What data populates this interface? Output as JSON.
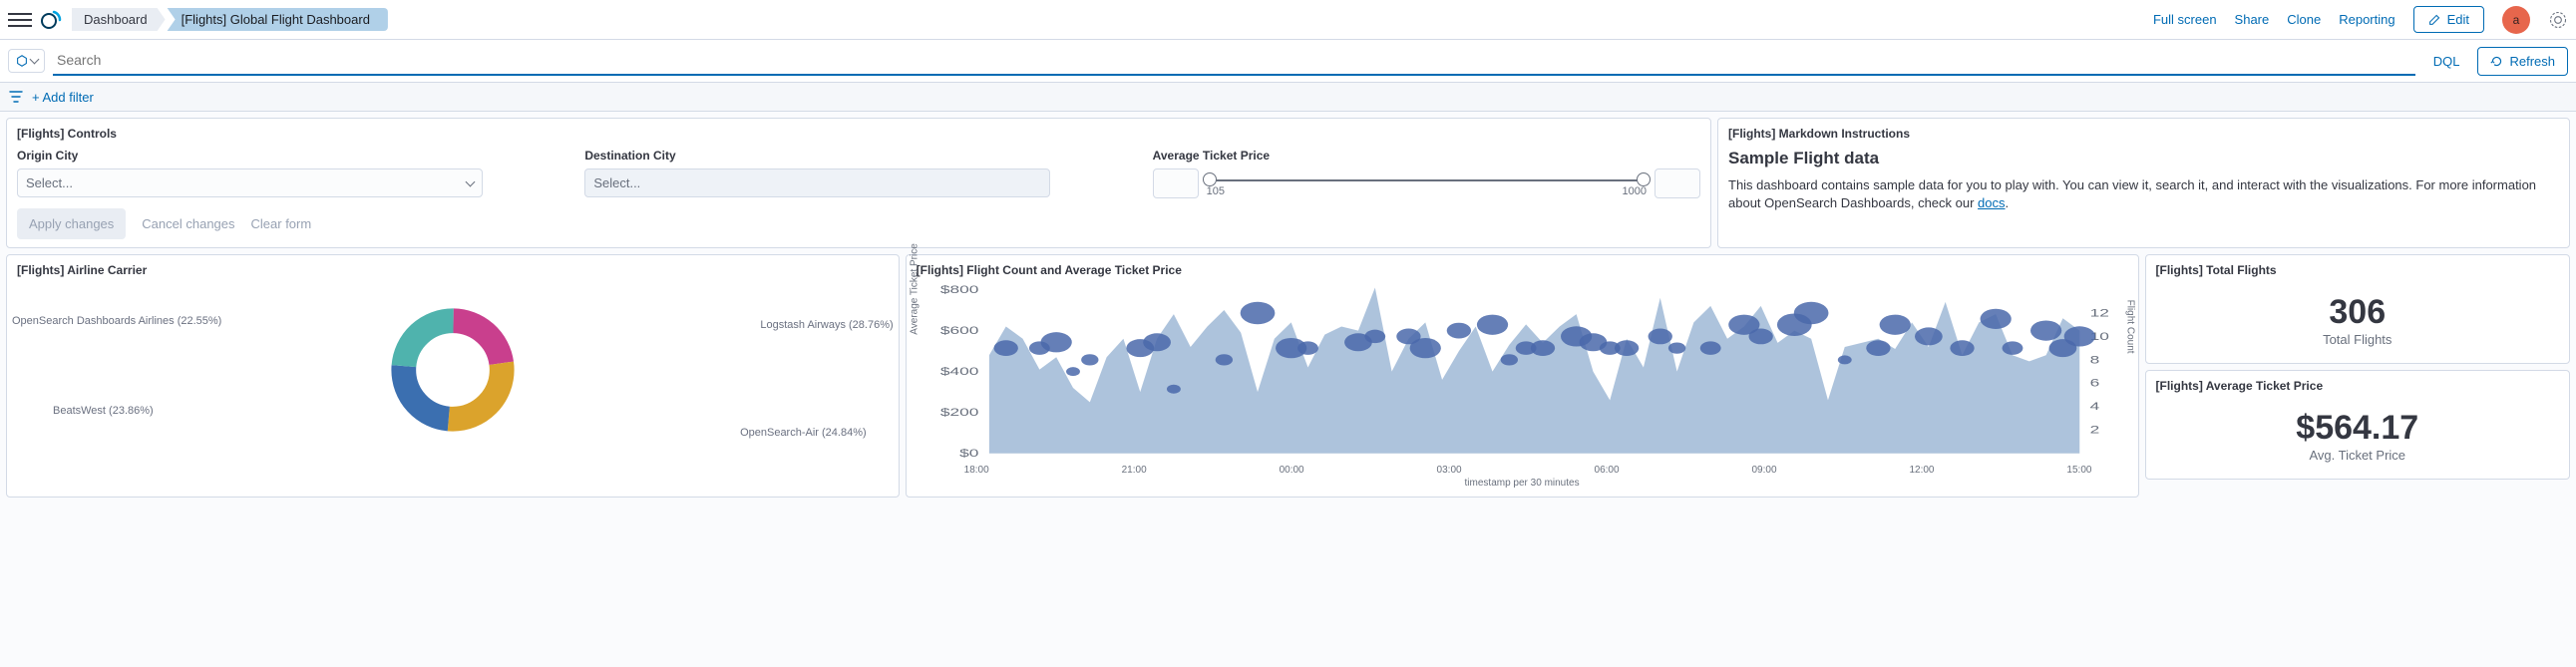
{
  "header": {
    "breadcrumbs": [
      "Dashboard",
      "[Flights] Global Flight Dashboard"
    ],
    "actions": {
      "fullscreen": "Full screen",
      "share": "Share",
      "clone": "Clone",
      "reporting": "Reporting",
      "edit": "Edit"
    },
    "avatar_initial": "a"
  },
  "search": {
    "placeholder": "Search",
    "dql": "DQL",
    "refresh": "Refresh"
  },
  "filters": {
    "add": "+ Add filter"
  },
  "controls_panel": {
    "title": "[Flights] Controls",
    "origin_label": "Origin City",
    "origin_placeholder": "Select...",
    "dest_label": "Destination City",
    "dest_placeholder": "Select...",
    "slider_label": "Average Ticket Price",
    "slider_min": "105",
    "slider_max": "1000",
    "apply": "Apply changes",
    "cancel": "Cancel changes",
    "clear": "Clear form"
  },
  "markdown_panel": {
    "title": "[Flights] Markdown Instructions",
    "heading": "Sample Flight data",
    "body_before": "This dashboard contains sample data for you to play with. You can view it, search it, and interact with the visualizations. For more information about OpenSearch Dashboards, check our ",
    "link": "docs",
    "body_after": "."
  },
  "carrier_panel": {
    "title": "[Flights] Airline Carrier"
  },
  "combo_panel": {
    "title": "[Flights] Flight Count and Average Ticket Price",
    "ylabel_left": "Average Ticket Price",
    "ylabel_right": "Flight Count",
    "xlabel": "timestamp per 30 minutes"
  },
  "total_flights_panel": {
    "title": "[Flights] Total Flights",
    "value": "306",
    "sub": "Total Flights"
  },
  "avg_price_panel": {
    "title": "[Flights] Average Ticket Price",
    "value": "$564.17",
    "sub": "Avg. Ticket Price"
  },
  "colors": {
    "area": "#9fb8d6",
    "bubble": "#4a69aa",
    "donut1": "#c93f8d",
    "donut2": "#dba32c",
    "donut3": "#3b6fb0",
    "donut4": "#4fb3ad"
  },
  "chart_data": [
    {
      "type": "pie",
      "title": "[Flights] Airline Carrier",
      "series": [
        {
          "name": "Logstash Airways",
          "value": 28.76
        },
        {
          "name": "OpenSearch-Air",
          "value": 24.84
        },
        {
          "name": "BeatsWest",
          "value": 23.86
        },
        {
          "name": "OpenSearch Dashboards Airlines",
          "value": 22.55
        }
      ],
      "label_format": "{name} ({value}%)"
    },
    {
      "type": "area_bubble_combo",
      "title": "[Flights] Flight Count and Average Ticket Price",
      "xlabel": "timestamp per 30 minutes",
      "x_ticks": [
        "18:00",
        "21:00",
        "00:00",
        "03:00",
        "06:00",
        "09:00",
        "12:00",
        "15:00"
      ],
      "area_series": {
        "name": "Average Ticket Price",
        "ylim": [
          0,
          800
        ],
        "y_ticks": [
          0,
          200,
          400,
          600,
          800
        ],
        "values": [
          480,
          620,
          560,
          410,
          470,
          320,
          250,
          470,
          560,
          300,
          560,
          680,
          520,
          620,
          700,
          590,
          300,
          560,
          640,
          420,
          580,
          620,
          600,
          810,
          400,
          560,
          640,
          360,
          500,
          620,
          400,
          530,
          630,
          540,
          620,
          680,
          400,
          260,
          560,
          420,
          760,
          400,
          640,
          720,
          560,
          620,
          720,
          540,
          600,
          560,
          260,
          520,
          540,
          560,
          510,
          640,
          520,
          740,
          480,
          640,
          680,
          480,
          450,
          480,
          660,
          600
        ]
      },
      "bubble_series": {
        "name": "Flight Count",
        "ylim": [
          0,
          14
        ],
        "y_ticks": [
          2,
          4,
          6,
          8,
          10,
          12
        ],
        "points": [
          {
            "i": 1,
            "y": 9,
            "s": 7
          },
          {
            "i": 3,
            "y": 9,
            "s": 6
          },
          {
            "i": 4,
            "y": 9.5,
            "s": 9
          },
          {
            "i": 5,
            "y": 7,
            "s": 4
          },
          {
            "i": 6,
            "y": 8,
            "s": 5
          },
          {
            "i": 9,
            "y": 9,
            "s": 8
          },
          {
            "i": 10,
            "y": 9.5,
            "s": 8
          },
          {
            "i": 11,
            "y": 5.5,
            "s": 4
          },
          {
            "i": 14,
            "y": 8,
            "s": 5
          },
          {
            "i": 16,
            "y": 12,
            "s": 10
          },
          {
            "i": 18,
            "y": 9,
            "s": 9
          },
          {
            "i": 19,
            "y": 9,
            "s": 6
          },
          {
            "i": 22,
            "y": 9.5,
            "s": 8
          },
          {
            "i": 23,
            "y": 10,
            "s": 6
          },
          {
            "i": 25,
            "y": 10,
            "s": 7
          },
          {
            "i": 26,
            "y": 9,
            "s": 9
          },
          {
            "i": 28,
            "y": 10.5,
            "s": 7
          },
          {
            "i": 30,
            "y": 11,
            "s": 9
          },
          {
            "i": 31,
            "y": 8,
            "s": 5
          },
          {
            "i": 32,
            "y": 9,
            "s": 6
          },
          {
            "i": 33,
            "y": 9,
            "s": 7
          },
          {
            "i": 35,
            "y": 10,
            "s": 9
          },
          {
            "i": 36,
            "y": 9.5,
            "s": 8
          },
          {
            "i": 37,
            "y": 9,
            "s": 6
          },
          {
            "i": 38,
            "y": 9,
            "s": 7
          },
          {
            "i": 40,
            "y": 10,
            "s": 7
          },
          {
            "i": 41,
            "y": 9,
            "s": 5
          },
          {
            "i": 43,
            "y": 9,
            "s": 6
          },
          {
            "i": 45,
            "y": 11,
            "s": 9
          },
          {
            "i": 46,
            "y": 10,
            "s": 7
          },
          {
            "i": 48,
            "y": 11,
            "s": 10
          },
          {
            "i": 49,
            "y": 12,
            "s": 10
          },
          {
            "i": 51,
            "y": 8,
            "s": 4
          },
          {
            "i": 53,
            "y": 9,
            "s": 7
          },
          {
            "i": 54,
            "y": 11,
            "s": 9
          },
          {
            "i": 56,
            "y": 10,
            "s": 8
          },
          {
            "i": 58,
            "y": 9,
            "s": 7
          },
          {
            "i": 60,
            "y": 11.5,
            "s": 9
          },
          {
            "i": 61,
            "y": 9,
            "s": 6
          },
          {
            "i": 63,
            "y": 10.5,
            "s": 9
          },
          {
            "i": 64,
            "y": 9,
            "s": 8
          },
          {
            "i": 65,
            "y": 10,
            "s": 9
          }
        ]
      }
    },
    {
      "type": "metric",
      "title": "[Flights] Total Flights",
      "value": 306,
      "label": "Total Flights"
    },
    {
      "type": "metric",
      "title": "[Flights] Average Ticket Price",
      "value": 564.17,
      "unit": "$",
      "label": "Avg. Ticket Price"
    }
  ]
}
